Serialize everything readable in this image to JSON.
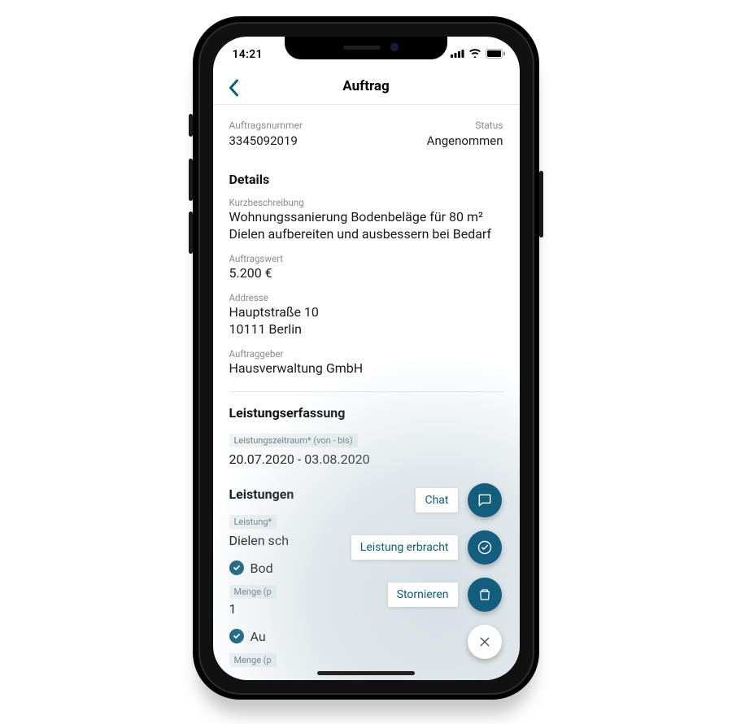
{
  "statusbar": {
    "time": "14:21"
  },
  "nav": {
    "title": "Auftrag"
  },
  "meta": {
    "order_no_label": "Auftragsnummer",
    "order_no": "3345092019",
    "status_label": "Status",
    "status": "Angenommen"
  },
  "details": {
    "heading": "Details",
    "desc_label": "Kurzbeschreibung",
    "desc_line1": "Wohnungssanierung Bodenbeläge für 80 m²",
    "desc_line2": "Dielen aufbereiten und ausbessern bei Bedarf",
    "value_label": "Auftragswert",
    "value": "5.200 €",
    "address_label": "Addresse",
    "address_line1": "Hauptstraße 10",
    "address_line2": "10111 Berlin",
    "client_label": "Auftraggeber",
    "client": "Hausverwaltung GmbH"
  },
  "capture": {
    "heading": "Leistungserfassung",
    "period_label": "Leistungszeitraum* (von - bis)",
    "period_value": "20.07.2020 - 03.08.2020"
  },
  "services": {
    "heading": "Leistungen",
    "service_label": "Leistung*",
    "service_value_partial": "Dielen sch",
    "item1_partial": "Bod",
    "qty_label_partial": "Menge (p",
    "qty_value": "1",
    "item2_partial": "Au"
  },
  "actions": {
    "chat": "Chat",
    "done": "Leistung erbracht",
    "cancel": "Stornieren"
  },
  "colors": {
    "brand": "#135e7e"
  }
}
